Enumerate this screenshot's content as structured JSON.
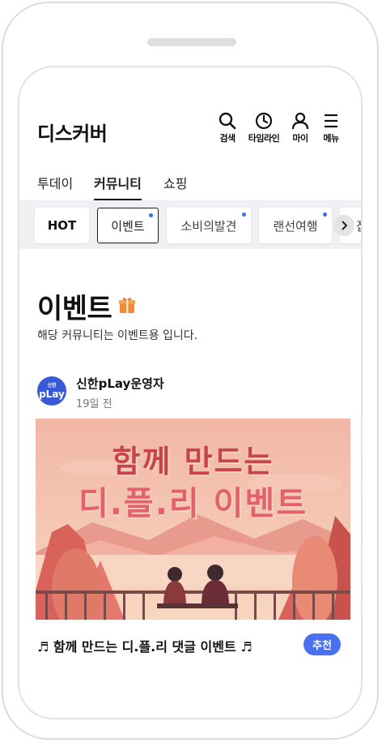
{
  "header": {
    "title": "디스커버",
    "actions": [
      {
        "icon": "search-icon",
        "label": "검색"
      },
      {
        "icon": "clock-icon",
        "label": "타임라인"
      },
      {
        "icon": "person-icon",
        "label": "마이"
      },
      {
        "icon": "menu-icon",
        "label": "메뉴"
      }
    ]
  },
  "tabs": [
    {
      "label": "투데이"
    },
    {
      "label": "커뮤니티",
      "active": true
    },
    {
      "label": "쇼핑"
    }
  ],
  "chips": [
    {
      "label": "HOT"
    },
    {
      "label": "이벤트",
      "active": true,
      "new_dot": true
    },
    {
      "label": "소비의발견",
      "new_dot": true
    },
    {
      "label": "랜선여행",
      "new_dot": true
    },
    {
      "label": "잡"
    }
  ],
  "page": {
    "title": "이벤트",
    "description": "해당 커뮤니티는 이벤트용 입니다."
  },
  "post": {
    "avatar_top": "신한",
    "avatar_main": "pLay",
    "author": "신한pLay운영자",
    "time": "19일 전",
    "banner_line1": "함께 만드는",
    "banner_line2": "디.플.리 이벤트",
    "title": "♬ 함께 만드는 디.플.리 댓글 이벤트 ♬",
    "badge": "추천"
  },
  "colors": {
    "accent": "#4a6ff0",
    "dot": "#3b6ef5",
    "banner_bg": "#f3c2b0"
  }
}
